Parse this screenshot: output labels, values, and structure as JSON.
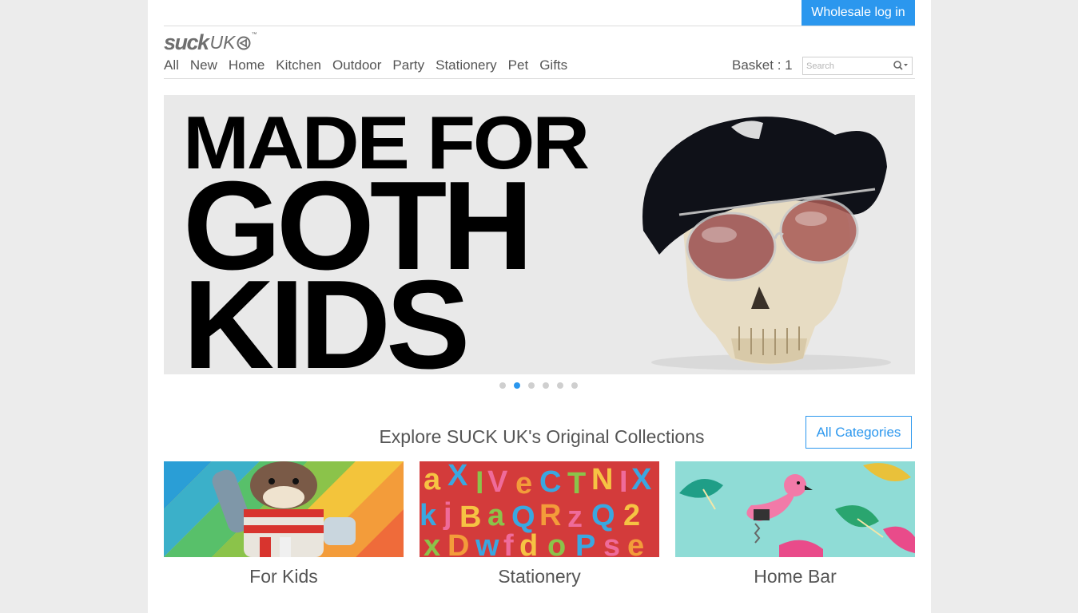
{
  "header": {
    "wholesale_label": "Wholesale log in",
    "logo_text": "suck",
    "logo_suffix": "UK",
    "logo_tm": "™",
    "basket_label": "Basket : 1",
    "search_placeholder": "Search"
  },
  "nav": [
    "All",
    "New",
    "Home",
    "Kitchen",
    "Outdoor",
    "Party",
    "Stationery",
    "Pet",
    "Gifts"
  ],
  "hero": {
    "line1": "MADE FOR",
    "line2": "GOTH",
    "line3": "KIDS",
    "active_slide": 2,
    "slide_count": 6
  },
  "collections": {
    "heading": "Explore SUCK UK's Original Collections",
    "all_categories_label": "All Categories",
    "tiles": [
      {
        "label": "For Kids"
      },
      {
        "label": "Stationery"
      },
      {
        "label": "Home Bar"
      }
    ]
  },
  "colors": {
    "accent": "#2b97ee",
    "text": "#555555",
    "page_bg": "#ececec"
  }
}
